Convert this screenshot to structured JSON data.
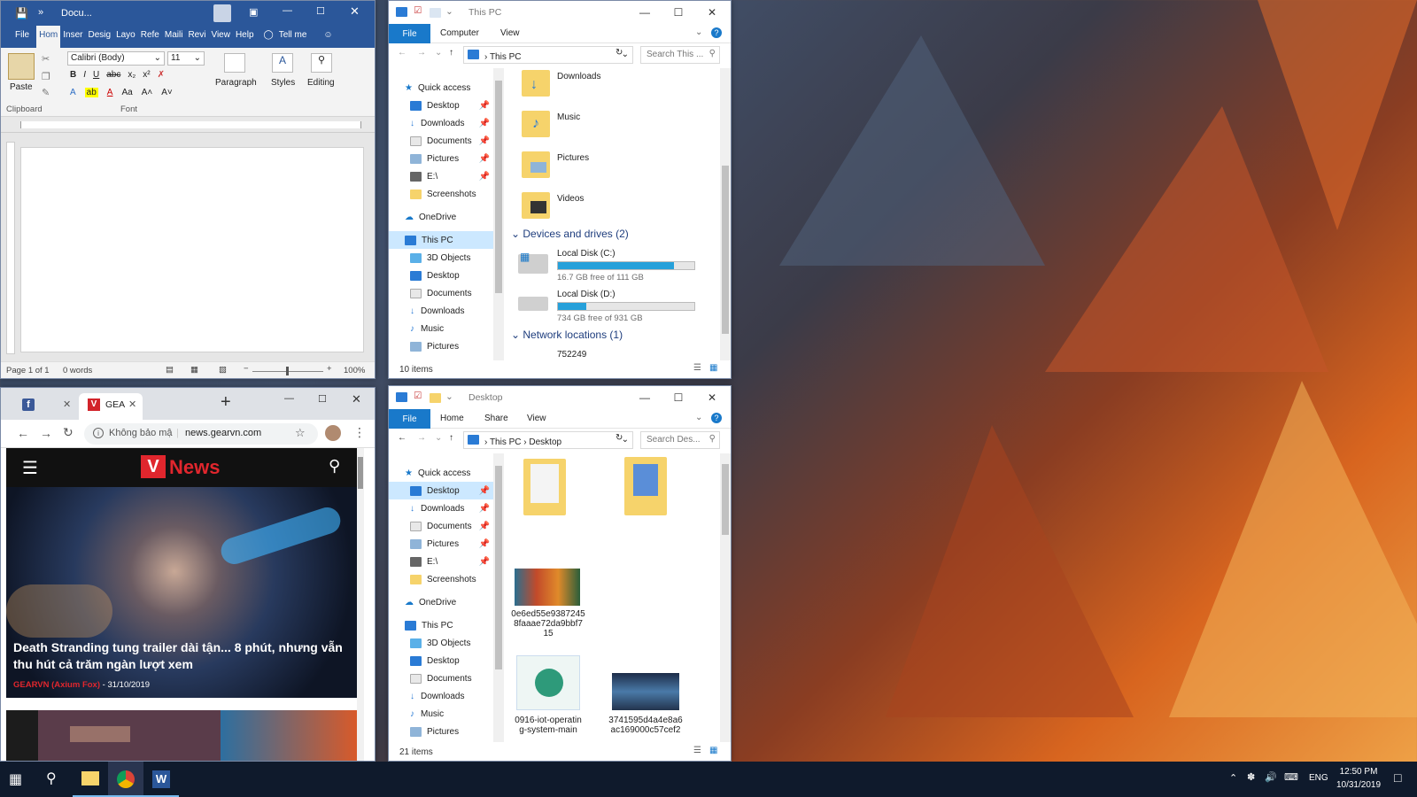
{
  "word": {
    "title": "Docu...",
    "tabs": [
      "File",
      "Hom",
      "Inser",
      "Desig",
      "Layo",
      "Refe",
      "Maili",
      "Revi",
      "View",
      "Help"
    ],
    "tell_me": "Tell me",
    "font_name": "Calibri (Body)",
    "font_size": "11",
    "groups": {
      "paste": "Paste",
      "clipboard": "Clipboard",
      "font": "Font",
      "paragraph": "Paragraph",
      "styles": "Styles",
      "editing": "Editing"
    },
    "status_page": "Page 1 of 1",
    "status_words": "0 words",
    "zoom": "100%"
  },
  "explorer_top": {
    "title": "This PC",
    "tabs": [
      "File",
      "Computer",
      "View"
    ],
    "address": "This PC",
    "search_placeholder": "Search This ...",
    "nav": [
      "Quick access",
      "Desktop",
      "Downloads",
      "Documents",
      "Pictures",
      "E:\\",
      "Screenshots",
      "OneDrive",
      "This PC",
      "3D Objects",
      "Desktop",
      "Documents",
      "Downloads",
      "Music",
      "Pictures"
    ],
    "folders": [
      "Downloads",
      "Music",
      "Pictures",
      "Videos"
    ],
    "devices_header": "Devices and drives (2)",
    "drives": [
      {
        "name": "Local Disk (C:)",
        "free": "16.7 GB free of 111 GB",
        "used_pct": 85
      },
      {
        "name": "Local Disk (D:)",
        "free": "734 GB free of 931 GB",
        "used_pct": 21
      }
    ],
    "network_header": "Network locations (1)",
    "network_item": "752249",
    "status": "10 items"
  },
  "explorer_bottom": {
    "title": "Desktop",
    "tabs": [
      "File",
      "Home",
      "Share",
      "View"
    ],
    "address_root": "This PC",
    "address_leaf": "Desktop",
    "search_placeholder": "Search Des...",
    "nav": [
      "Quick access",
      "Desktop",
      "Downloads",
      "Documents",
      "Pictures",
      "E:\\",
      "Screenshots",
      "OneDrive",
      "This PC",
      "3D Objects",
      "Desktop",
      "Documents",
      "Downloads",
      "Music",
      "Pictures"
    ],
    "files": [
      {
        "name": ""
      },
      {
        "name": ""
      },
      {
        "name": "0e6ed55e9387245 8faaae72da9bbf7 15"
      },
      {
        "name": "0916-iot-operatin g-system-main"
      },
      {
        "name": "3741595d4a4e8a6 ac169000c57cef2"
      }
    ],
    "status": "21 items"
  },
  "chrome": {
    "tab_title": "GEA",
    "insecure": "Không bảo mậ",
    "url": "news.gearvn.com",
    "logo": "News",
    "headline": "Death Stranding tung trailer dài tận... 8 phút, nhưng vẫn thu hút cả trăm ngàn lượt xem",
    "author": "GEARVN (Axium Fox)",
    "date": "31/10/2019"
  },
  "taskbar": {
    "lang": "ENG",
    "time": "12:50 PM",
    "date": "10/31/2019"
  }
}
